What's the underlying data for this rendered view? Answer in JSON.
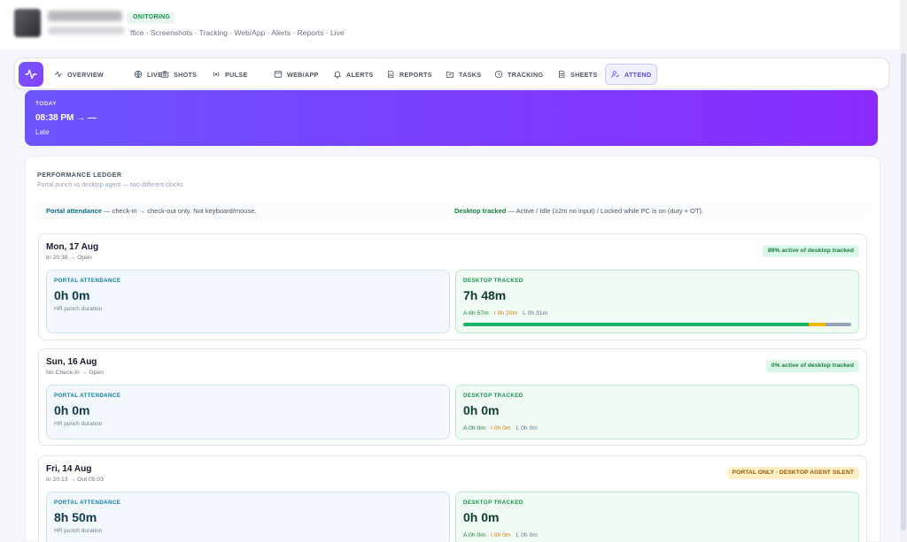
{
  "header": {
    "badge": "ONITORING",
    "breadcrumb": "ffice · Screenshots · Tracking · Web/App · Alerts · Reports · Live"
  },
  "nav": {
    "items": [
      {
        "label": "OVERVIEW",
        "icon": "activity-icon"
      },
      {
        "label": "LIVE",
        "icon": "globe-icon"
      },
      {
        "label": "SHOTS",
        "icon": "camera-icon"
      },
      {
        "label": "PULSE",
        "icon": "pulse-icon"
      },
      {
        "label": "WEB/APP",
        "icon": "window-icon"
      },
      {
        "label": "ALERTS",
        "icon": "bell-icon"
      },
      {
        "label": "REPORTS",
        "icon": "document-icon"
      },
      {
        "label": "TASKS",
        "icon": "folder-icon"
      },
      {
        "label": "TRACKING",
        "icon": "clock-icon"
      },
      {
        "label": "SHEETS",
        "icon": "sheet-icon"
      },
      {
        "label": "ATTEND",
        "icon": "user-check-icon",
        "active": true
      }
    ]
  },
  "today": {
    "label": "TODAY",
    "time": "08:38 PM → —",
    "status": "Late"
  },
  "ledger": {
    "title": "PERFORMANCE LEDGER",
    "subtitle": "Portal punch vs desktop agent — two different clocks",
    "legend_portal_key": "Portal attendance",
    "legend_portal_text": " — check-in → check-out only. Not keyboard/mouse.",
    "legend_desktop_key": "Desktop tracked",
    "legend_desktop_text": " — Active / Idle (≥2m no input) / Locked while PC is on (duty + OT)."
  },
  "days": [
    {
      "title": "Mon, 17 Aug",
      "sub": "In 20:38 → Open",
      "pill": "89% active of desktop tracked",
      "pill_type": "green",
      "portal_label": "PORTAL ATTENDANCE",
      "portal_value": "0h 0m",
      "portal_note": "HR punch duration",
      "desk_label": "DESKTOP TRACKED",
      "desk_value": "7h 48m",
      "active": "A 6h 57m",
      "idle": "I 0h 20m",
      "locked": "L 0h 31m",
      "bar": {
        "active": 0.89,
        "idle": 0.043,
        "locked": 0.066
      }
    },
    {
      "title": "Sun, 16 Aug",
      "sub": "No Check-In → Open",
      "pill": "0% active of desktop tracked",
      "pill_type": "green",
      "portal_label": "PORTAL ATTENDANCE",
      "portal_value": "0h 0m",
      "portal_note": "HR punch duration",
      "desk_label": "DESKTOP TRACKED",
      "desk_value": "0h 0m",
      "active": "A 0h 0m",
      "idle": "I 0h 0m",
      "locked": "L 0h 0m"
    },
    {
      "title": "Fri, 14 Aug",
      "sub": "In 20:13 → Out 05:03",
      "pill": "PORTAL ONLY · DESKTOP AGENT SILENT",
      "pill_type": "amber",
      "portal_label": "PORTAL ATTENDANCE",
      "portal_value": "8h 50m",
      "portal_note": "HR punch duration",
      "desk_label": "DESKTOP TRACKED",
      "desk_value": "0h 0m",
      "active": "A 0h 0m",
      "idle": "I 0h 0m",
      "locked": "L 0h 0m"
    }
  ],
  "colors": {
    "accent": "#7c3cff",
    "active": "#16b364",
    "idle": "#f5b800",
    "locked": "#94a3b8"
  }
}
